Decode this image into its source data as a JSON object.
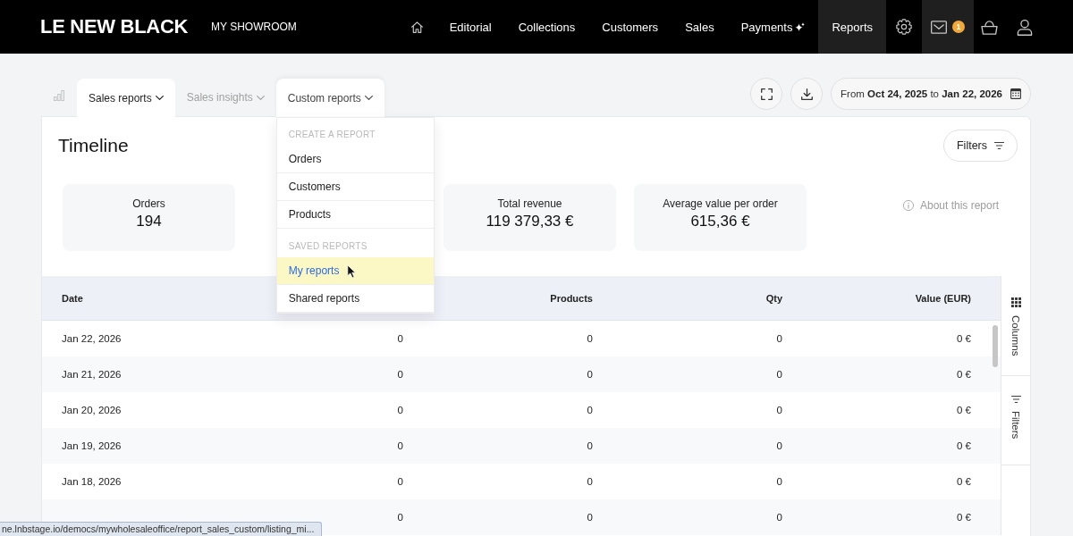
{
  "nav": {
    "logo": "LE NEW BLACK",
    "showroom": "MY SHOWROOM",
    "links": [
      {
        "label": "Editorial",
        "selected": false,
        "new": false
      },
      {
        "label": "Collections",
        "selected": false,
        "new": false
      },
      {
        "label": "Customers",
        "selected": false,
        "new": false
      },
      {
        "label": "Sales",
        "selected": false,
        "new": false
      },
      {
        "label": "Payments",
        "selected": false,
        "new": true
      },
      {
        "label": "Reports",
        "selected": true,
        "new": false
      }
    ],
    "inbox": {
      "badge": "1",
      "active": true
    }
  },
  "report_tabs": [
    {
      "label": "Sales reports",
      "selected": true,
      "open": false
    },
    {
      "label": "Sales insights",
      "selected": false,
      "open": false
    },
    {
      "label": "Custom reports",
      "selected": false,
      "open": true
    }
  ],
  "date_range": "From **Oct 24, 2025** to **Jan 22, 2026**",
  "custom_reports_menu": {
    "sections": [
      {
        "heading": "CREATE A REPORT",
        "items": [
          {
            "label": "Orders",
            "selected": false
          },
          {
            "label": "Customers",
            "selected": false
          },
          {
            "label": "Products",
            "selected": false
          }
        ]
      },
      {
        "heading": "SAVED REPORTS",
        "items": [
          {
            "label": "My reports",
            "selected": true
          },
          {
            "label": "Shared reports",
            "selected": false
          }
        ]
      }
    ]
  },
  "report": {
    "title": "Timeline",
    "filters_button": "Filters",
    "kpis": [
      {
        "label": "Orders",
        "value": "194"
      },
      {
        "label": "Total revenue",
        "value": "119 379,33 €"
      },
      {
        "label": "Average value per order",
        "value": "615,36 €"
      }
    ],
    "about_link": "About this report"
  },
  "table": {
    "columns": [
      "Date",
      null,
      "Products",
      "Qty",
      "Value (EUR)"
    ],
    "rows": [
      [
        "Jan 22, 2026",
        "0",
        "0",
        "0",
        "0 €"
      ],
      [
        "Jan 21, 2026",
        "0",
        "0",
        "0",
        "0 €"
      ],
      [
        "Jan 20, 2026",
        "0",
        "0",
        "0",
        "0 €"
      ],
      [
        "Jan 19, 2026",
        "0",
        "0",
        "0",
        "0 €"
      ],
      [
        "Jan 18, 2026",
        "0",
        "0",
        "0",
        "0 €"
      ],
      [
        null,
        "0",
        "0",
        "0",
        "0 €"
      ]
    ],
    "side_panel": [
      "Columns",
      "Filters"
    ]
  },
  "status_bar": {
    "url": "ne.lnbstage.io/democs/mywholesaleoffice/report_sales_custom/listing_mi..."
  }
}
